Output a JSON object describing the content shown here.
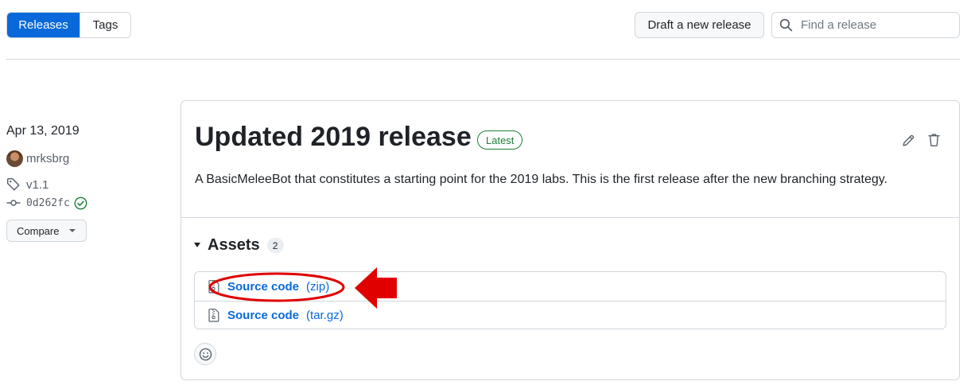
{
  "tabs": [
    {
      "label": "Releases",
      "active": true
    },
    {
      "label": "Tags",
      "active": false
    }
  ],
  "toolbar": {
    "draft_label": "Draft a new release",
    "search_placeholder": "Find a release",
    "search_value": ""
  },
  "release": {
    "date": "Apr 13, 2019",
    "author": "mrksbrg",
    "tag": "v1.1",
    "commit": "0d262fc",
    "compare_label": "Compare",
    "title": "Updated 2019 release",
    "badge": "Latest",
    "description": "A BasicMeleeBot that constitutes a starting point for the 2019 labs. This is the first release after the new branching strategy.",
    "assets_label": "Assets",
    "assets_count": "2",
    "assets": [
      {
        "name": "Source code",
        "ext": "(zip)",
        "icon": "file-zip-icon"
      },
      {
        "name": "Source code",
        "ext": "(tar.gz)",
        "icon": "file-zip-icon"
      }
    ]
  },
  "colors": {
    "accent": "#0969da",
    "latest_green": "#1a7f37",
    "annotation_red": "#e00000",
    "border": "#d0d7de"
  }
}
